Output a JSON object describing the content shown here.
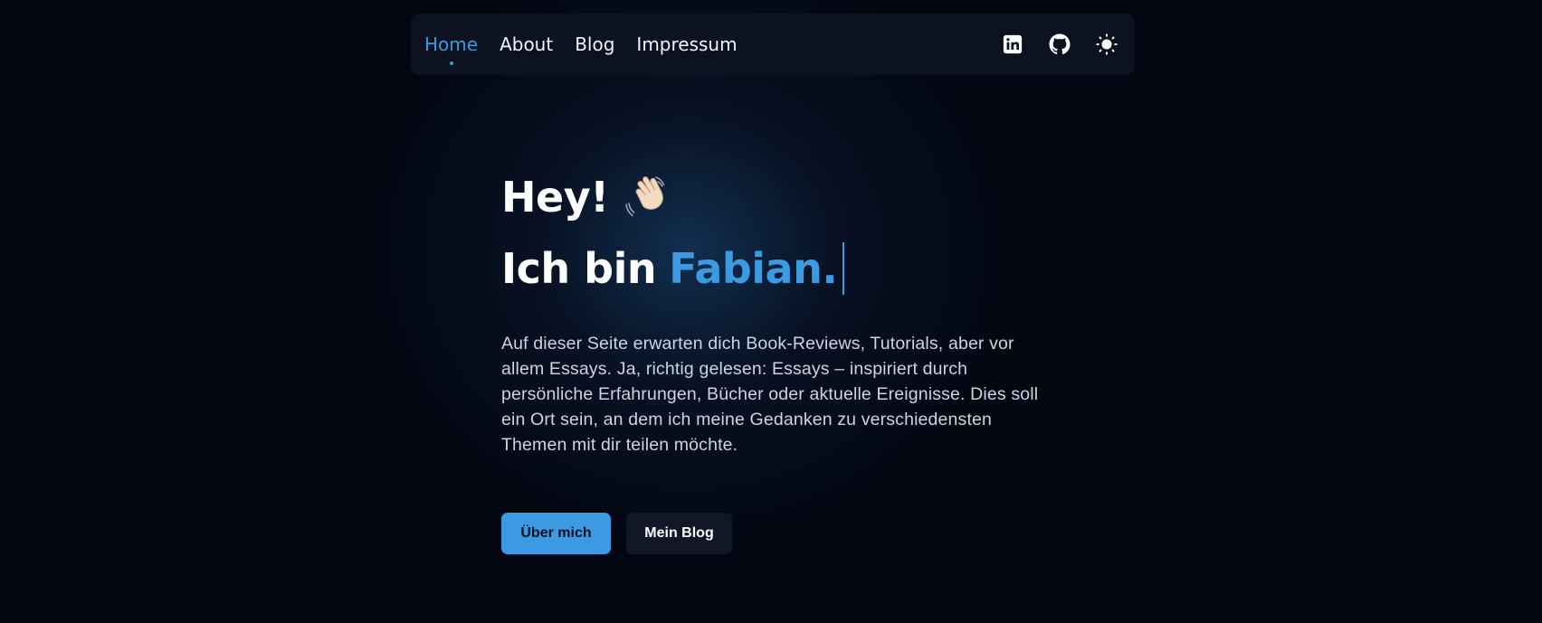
{
  "nav": {
    "links": [
      {
        "label": "Home",
        "active": true
      },
      {
        "label": "About",
        "active": false
      },
      {
        "label": "Blog",
        "active": false
      },
      {
        "label": "Impressum",
        "active": false
      }
    ],
    "icons": [
      "linkedin-icon",
      "github-icon",
      "sun-icon"
    ]
  },
  "hero": {
    "greeting": "Hey!",
    "wave_emoji": "waving-hand-icon",
    "intro_prefix": "Ich bin",
    "name": "Fabian.",
    "description": "Auf dieser Seite erwarten dich Book-Reviews, Tutorials, aber vor allem Essays. Ja, richtig gelesen: Essays – inspiriert durch persönliche Erfahrungen, Bücher oder aktuelle Ereignisse. Dies soll ein Ort sein, an dem ich meine Gedanken zu verschiedens­ten Themen mit dir teilen möchte.",
    "primary_button": "Über mich",
    "secondary_button": "Mein Blog"
  },
  "colors": {
    "accent": "#3b9ae1",
    "background": "#030712",
    "nav_background": "#0d1221",
    "text": "#f3f4f6",
    "muted_text": "#cbd5e1"
  }
}
